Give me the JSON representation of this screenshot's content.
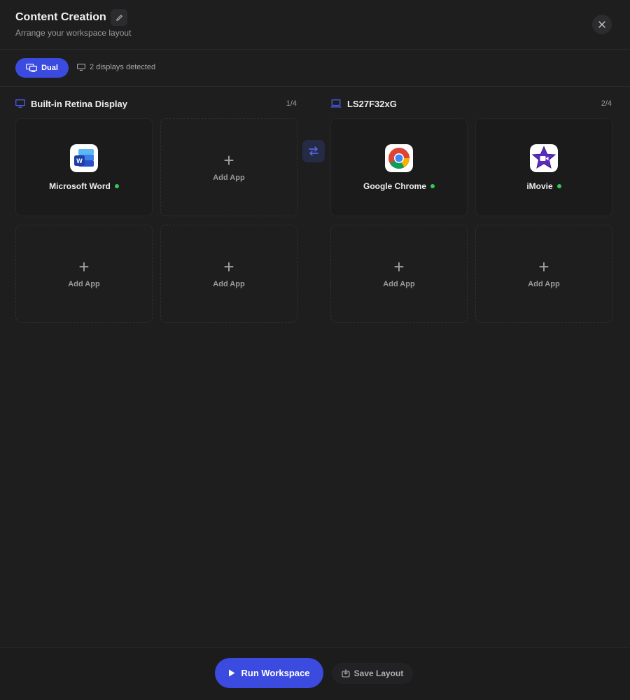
{
  "header": {
    "title": "Content Creation",
    "subtitle": "Arrange your workspace layout"
  },
  "toolbar": {
    "mode_label": "Dual",
    "displays_info": "2 displays detected"
  },
  "displays": [
    {
      "name": "Built-in Retina Display",
      "count": "1/4",
      "icon": "monitor-icon",
      "slots": [
        {
          "type": "app",
          "name": "Microsoft Word",
          "icon": "microsoft-word-icon",
          "status": "running"
        },
        {
          "type": "empty",
          "label": "Add App"
        },
        {
          "type": "empty",
          "label": "Add App"
        },
        {
          "type": "empty",
          "label": "Add App"
        }
      ]
    },
    {
      "name": "LS27F32xG",
      "count": "2/4",
      "icon": "laptop-icon",
      "slots": [
        {
          "type": "app",
          "name": "Google Chrome",
          "icon": "google-chrome-icon",
          "status": "running"
        },
        {
          "type": "app",
          "name": "iMovie",
          "icon": "imovie-icon",
          "status": "running"
        },
        {
          "type": "empty",
          "label": "Add App"
        },
        {
          "type": "empty",
          "label": "Add App"
        }
      ]
    }
  ],
  "footer": {
    "run_label": "Run Workspace",
    "save_label": "Save Layout"
  },
  "colors": {
    "accent": "#3b4be0",
    "running": "#34c759",
    "background": "#1e1e1f"
  }
}
